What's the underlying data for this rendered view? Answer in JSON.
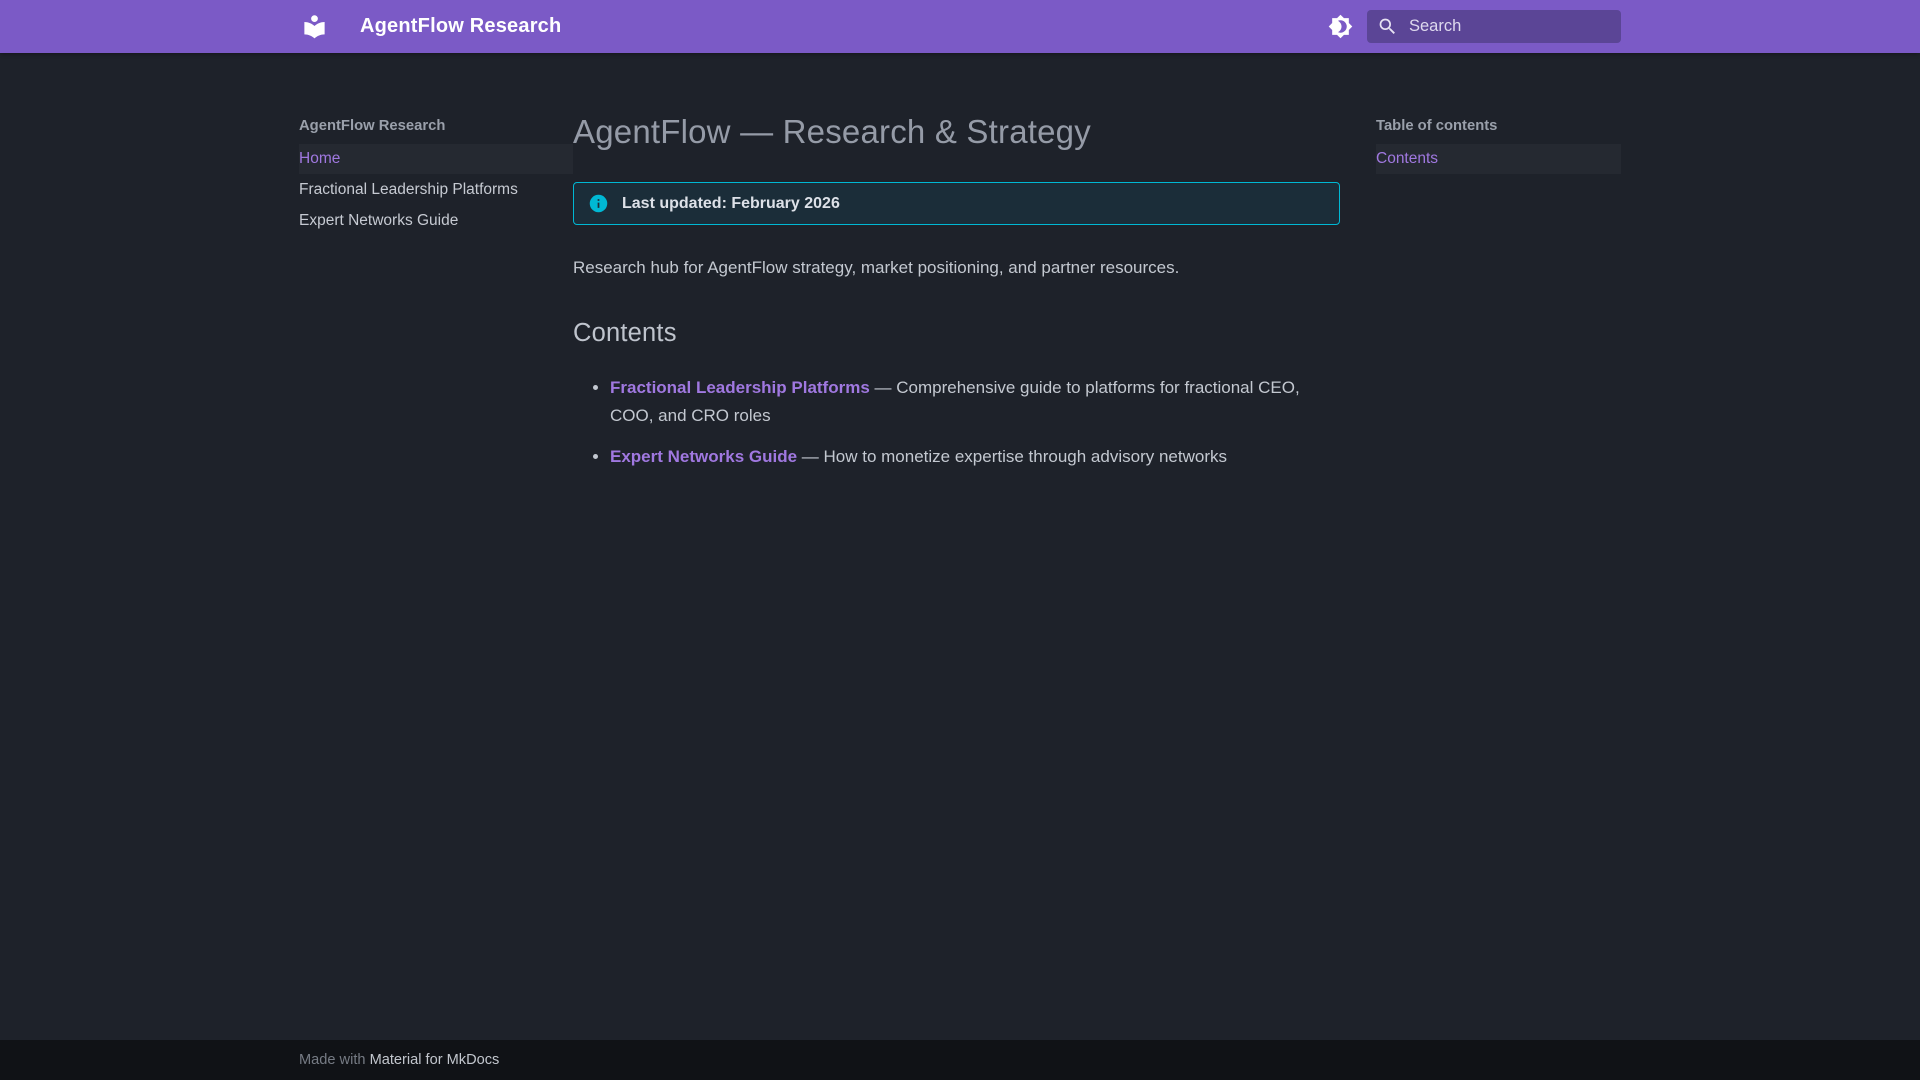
{
  "header": {
    "title": "AgentFlow Research",
    "search_placeholder": "Search"
  },
  "sidebar": {
    "title": "AgentFlow Research",
    "items": [
      {
        "label": "Home",
        "active": true
      },
      {
        "label": "Fractional Leadership Platforms",
        "active": false
      },
      {
        "label": "Expert Networks Guide",
        "active": false
      }
    ]
  },
  "toc": {
    "title": "Table of contents",
    "items": [
      {
        "label": "Contents",
        "active": true
      }
    ]
  },
  "main": {
    "page_title": "AgentFlow — Research & Strategy",
    "admonition": {
      "type": "info",
      "text": "Last updated: February 2026"
    },
    "intro": "Research hub for AgentFlow strategy, market positioning, and partner resources.",
    "contents_heading": "Contents",
    "list": [
      {
        "link": "Fractional Leadership Platforms",
        "description": " — Comprehensive guide to platforms for fractional CEO, COO, and CRO roles"
      },
      {
        "link": "Expert Networks Guide",
        "description": " — How to monetize expertise through advisory networks"
      }
    ]
  },
  "footer": {
    "made_with": "Made with ",
    "link": "Material for MkDocs"
  },
  "colors": {
    "primary": "#7b5ac6",
    "search_bg": "#5b4596",
    "background": "#1e222a",
    "footer_bg": "#101216",
    "link_accent": "#a078e0",
    "info_border": "#00b8d4",
    "info_bg": "#1b2d39"
  }
}
